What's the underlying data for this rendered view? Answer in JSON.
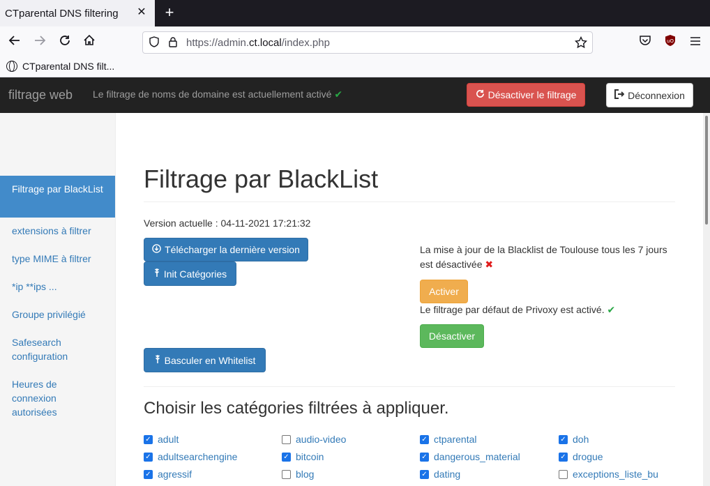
{
  "browser": {
    "tab_title": "CTparental DNS filtering",
    "tab_close": "✕",
    "new_tab": "+",
    "url_prefix": "https://admin.",
    "url_domain": "ct.local",
    "url_path": "/index.php",
    "bookmark": "CTparental DNS filt..."
  },
  "header": {
    "brand": "filtrage web",
    "status": "Le filtrage de noms de domaine est actuellement activé",
    "disable_button": "Désactiver le filtrage",
    "logout_button": "Déconnexion"
  },
  "sidebar": {
    "items": [
      {
        "label": "Filtrage par BlackList",
        "active": true
      },
      {
        "label": "extensions à filtrer",
        "active": false
      },
      {
        "label": "type MIME à filtrer",
        "active": false
      },
      {
        "label": "*ip **ips ...",
        "active": false
      },
      {
        "label": "Groupe privilégié",
        "active": false
      },
      {
        "label": "Safesearch configuration",
        "active": false
      },
      {
        "label": "Heures de connexion autorisées",
        "active": false
      }
    ]
  },
  "main": {
    "title": "Filtrage par BlackList",
    "version": "Version actuelle : 04-11-2021 17:21:32",
    "download_button": "Télécharger la dernière version",
    "init_button": "Init Catégories",
    "whitelist_button": "Basculer en Whitelist",
    "update_text_1": "La mise à jour de la Blacklist de Toulouse tous les 7 jours",
    "update_text_2": "est désactivée",
    "activate_button": "Activer",
    "privoxy_text": "Le filtrage par défaut de Privoxy est activé.",
    "deactivate_button": "Désactiver",
    "categories_title": "Choisir les catégories filtrées à appliquer."
  },
  "categories": [
    {
      "name": "adult",
      "checked": true
    },
    {
      "name": "audio-video",
      "checked": false
    },
    {
      "name": "ctparental",
      "checked": true
    },
    {
      "name": "doh",
      "checked": true
    },
    {
      "name": "adultsearchengine",
      "checked": true
    },
    {
      "name": "bitcoin",
      "checked": true
    },
    {
      "name": "dangerous_material",
      "checked": true
    },
    {
      "name": "drogue",
      "checked": true
    },
    {
      "name": "agressif",
      "checked": true
    },
    {
      "name": "blog",
      "checked": false
    },
    {
      "name": "dating",
      "checked": true
    },
    {
      "name": "exceptions_liste_bu",
      "checked": false
    }
  ],
  "colors": {
    "primary": "#337ab7",
    "danger": "#d9534f",
    "warning": "#f0ad4e",
    "success": "#5cb85c",
    "header_bg": "#222222"
  }
}
